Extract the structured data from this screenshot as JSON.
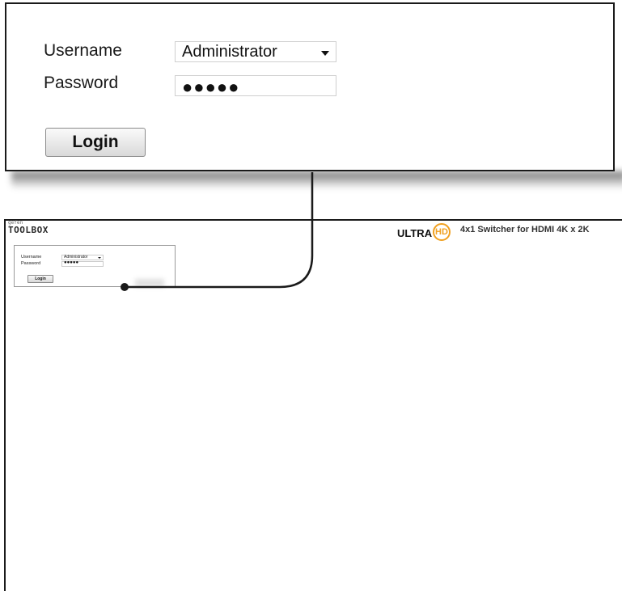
{
  "login_form": {
    "username_label": "Username",
    "username_value": "Administrator",
    "password_label": "Password",
    "password_value": "●●●●●",
    "login_label": "Login"
  },
  "header": {
    "logo_small": "gefen",
    "logo_text": "TOOLBOX",
    "ultra_text": "ULTRA",
    "hd_text": "HD",
    "product_title": "4x1 Switcher for HDMI 4K x 2K"
  }
}
